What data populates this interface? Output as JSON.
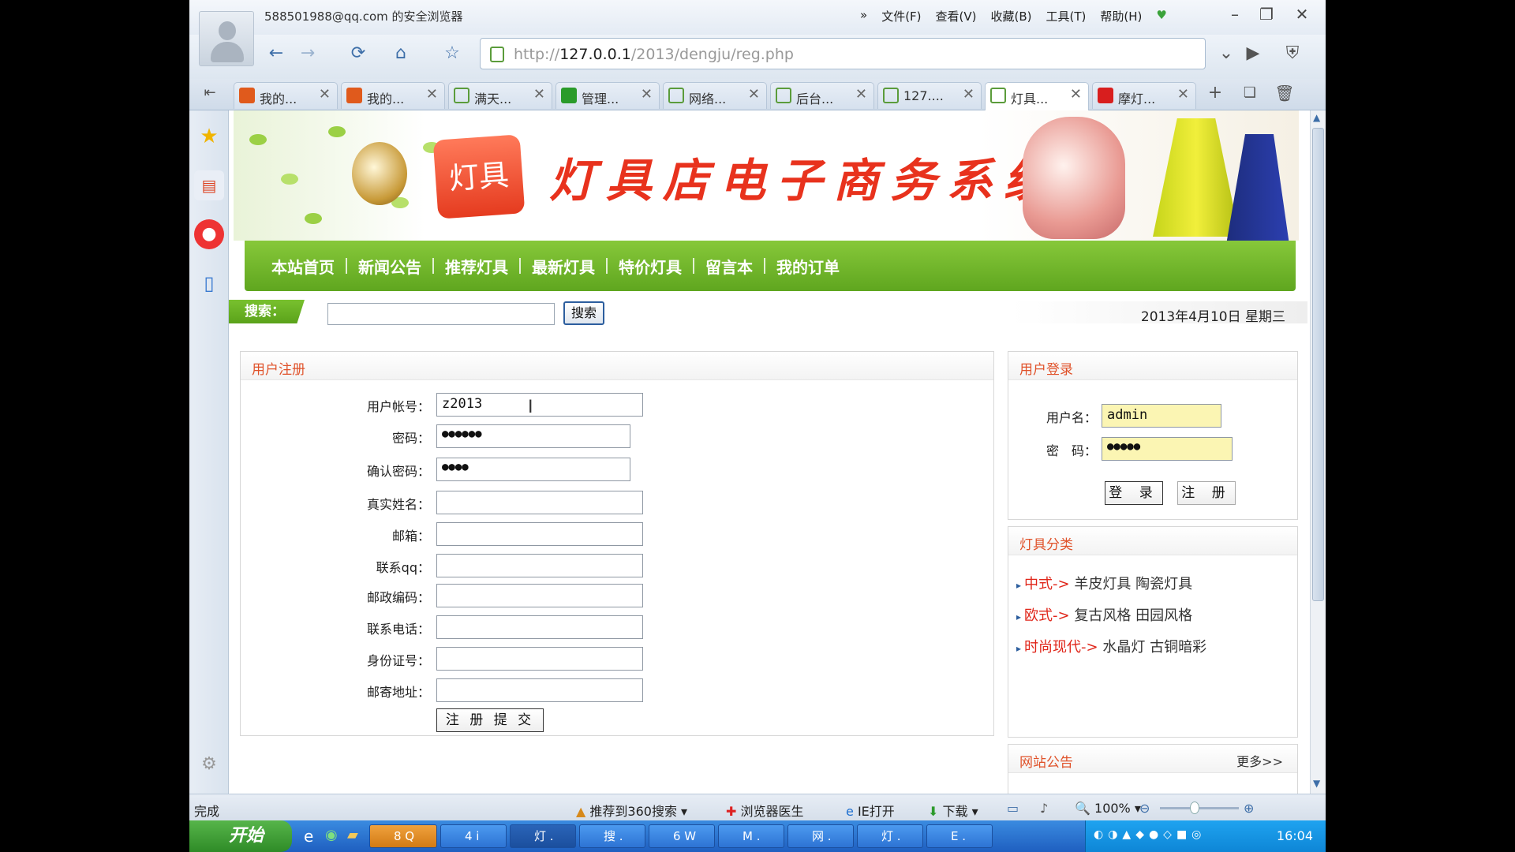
{
  "window": {
    "title": "588501988@qq.com 的安全浏览器",
    "menu": [
      "文件(F)",
      "查看(V)",
      "收藏(B)",
      "工具(T)",
      "帮助(H)"
    ]
  },
  "address_bar": {
    "url_prefix": "http://",
    "url_host": "127.0.0.1",
    "url_path": "/2013/dengju/reg.php"
  },
  "tabs": [
    {
      "label": "我的...",
      "icon_color": "#e05a1c"
    },
    {
      "label": "我的...",
      "icon_color": "#e05a1c"
    },
    {
      "label": "满天...",
      "icon_color": "#5b9c3b"
    },
    {
      "label": "管理...",
      "icon_color": "#2a9b2a"
    },
    {
      "label": "网络...",
      "icon_color": "#5b9c3b"
    },
    {
      "label": "后台...",
      "icon_color": "#5b9c3b"
    },
    {
      "label": "127....",
      "icon_color": "#5b9c3b"
    },
    {
      "label": "灯具...",
      "icon_color": "#5b9c3b"
    },
    {
      "label": "摩灯...",
      "icon_color": "#d81e1e"
    }
  ],
  "site": {
    "badge": "灯具",
    "title": "灯具店电子商务系统",
    "nav": [
      "本站首页",
      "新闻公告",
      "推荐灯具",
      "最新灯具",
      "特价灯具",
      "留言本",
      "我的订单"
    ],
    "search_label": "搜索：",
    "search_button": "搜索",
    "date": "2013年4月10日 星期三"
  },
  "register": {
    "heading": "用户注册",
    "fields": [
      {
        "label": "用户帐号：",
        "value": "z2013"
      },
      {
        "label": "密码：",
        "value": "●●●●●●"
      },
      {
        "label": "确认密码：",
        "value": "●●●●"
      },
      {
        "label": "真实姓名：",
        "value": ""
      },
      {
        "label": "邮箱：",
        "value": ""
      },
      {
        "label": "联系qq：",
        "value": ""
      },
      {
        "label": "邮政编码：",
        "value": ""
      },
      {
        "label": "联系电话：",
        "value": ""
      },
      {
        "label": "身份证号：",
        "value": ""
      },
      {
        "label": "邮寄地址：",
        "value": ""
      }
    ],
    "submit": "注 册 提 交"
  },
  "login": {
    "heading": "用户登录",
    "user_label": "用户名：",
    "user_value": "admin",
    "pass_label": "密　码：",
    "pass_value": "●●●●●",
    "login_button": "登 录",
    "register_button": "注 册"
  },
  "categories": {
    "heading": "灯具分类",
    "items": [
      {
        "main": "中式->",
        "subs": "羊皮灯具  陶瓷灯具"
      },
      {
        "main": "欧式->",
        "subs": "复古风格  田园风格"
      },
      {
        "main": "时尚现代->",
        "subs": "水晶灯  古铜暗彩"
      }
    ]
  },
  "notice": {
    "heading": "网站公告",
    "more": "更多>>"
  },
  "statusbar": {
    "status": "完成",
    "recommend": "推荐到360搜索",
    "doctor": "浏览器医生",
    "ie_open": "IE打开",
    "download": "下载",
    "zoom": "100%"
  },
  "taskbar": {
    "start": "开始",
    "items": [
      "8 Q",
      "4 i",
      "灯 .",
      "搜 .",
      "6 W",
      "M .",
      "网 .",
      "灯 .",
      "E ."
    ],
    "clock": "16:04"
  }
}
